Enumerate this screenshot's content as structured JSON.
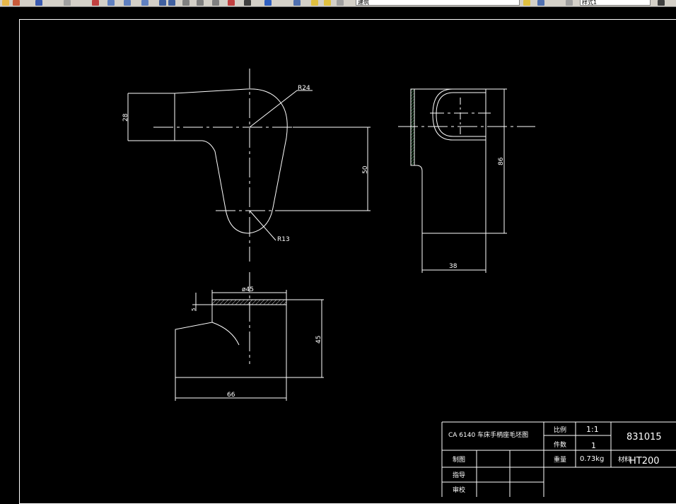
{
  "toolbar": {
    "layer_combo": "建筑",
    "style_combo": "样式1"
  },
  "drawing": {
    "dims": {
      "r24": "R24",
      "r13": "R13",
      "d28": "28",
      "d50": "50",
      "d86": "86",
      "d38": "38",
      "dia45": "ø45",
      "d45": "45",
      "d66": "66",
      "d5": "5"
    }
  },
  "title_block": {
    "title": "CA 6140 车床手柄座毛坯图",
    "scale_label": "比例",
    "scale_value": "1:1",
    "qty_label": "件数",
    "qty_value": "1",
    "weight_label": "重量",
    "weight_value": "0.73kg",
    "material_label": "材料",
    "material_value": "HT200",
    "drawing_no": "831015",
    "drawn_label": "制图",
    "guide_label": "指导",
    "review_label": "审校"
  }
}
